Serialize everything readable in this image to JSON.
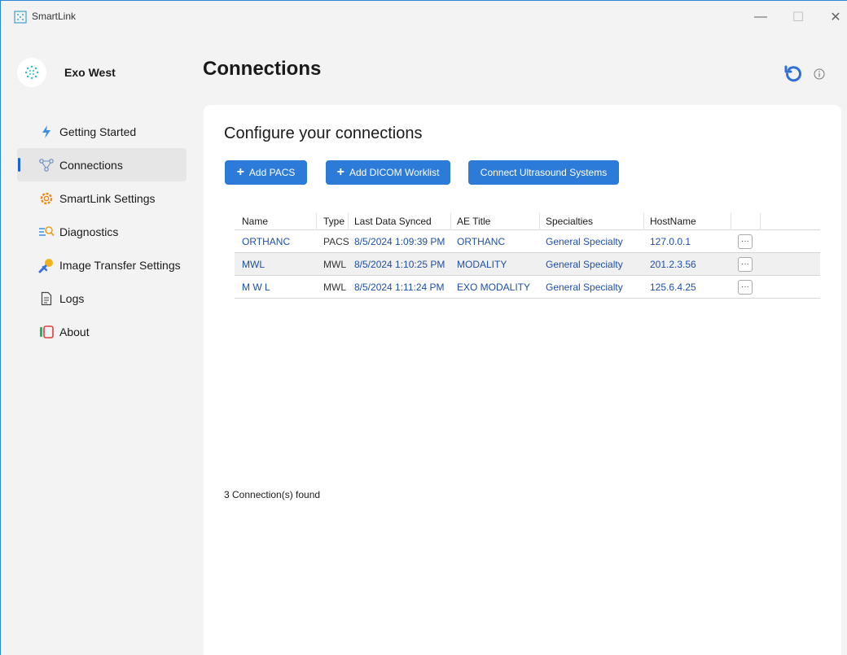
{
  "window": {
    "title": "SmartLink",
    "minimize_glyph": "—",
    "maximize_glyph": "☐",
    "close_glyph": "✕"
  },
  "profile": {
    "name": "Exo West"
  },
  "sidebar": {
    "items": [
      {
        "label": "Getting Started",
        "icon": "lightning-icon",
        "active": false
      },
      {
        "label": "Connections",
        "icon": "network-icon",
        "active": true
      },
      {
        "label": "SmartLink Settings",
        "icon": "gear-icon",
        "active": false
      },
      {
        "label": "Diagnostics",
        "icon": "magnifier-list-icon",
        "active": false
      },
      {
        "label": "Image Transfer Settings",
        "icon": "transfer-icon",
        "active": false
      },
      {
        "label": "Logs",
        "icon": "document-icon",
        "active": false
      },
      {
        "label": "About",
        "icon": "about-icon",
        "active": false
      }
    ]
  },
  "header": {
    "title": "Connections"
  },
  "main": {
    "heading": "Configure your connections",
    "buttons": {
      "add_pacs": "Add PACS",
      "add_worklist": "Add DICOM Worklist",
      "connect_us": "Connect Ultrasound Systems",
      "plus_glyph": "+"
    },
    "table": {
      "headers": [
        "Name",
        "Type",
        "Last Data Synced",
        "AE Title",
        "Specialties",
        "HostName"
      ],
      "rows": [
        {
          "name": "ORTHANC",
          "type": "PACS",
          "synced": "8/5/2024 1:09:39 PM",
          "ae": "ORTHANC",
          "specialty": "General Specialty",
          "host": "127.0.0.1",
          "more": "···"
        },
        {
          "name": "MWL",
          "type": "MWL",
          "synced": "8/5/2024 1:10:25 PM",
          "ae": "MODALITY",
          "specialty": "General Specialty",
          "host": "201.2.3.56",
          "more": "···"
        },
        {
          "name": "M W L",
          "type": "MWL",
          "synced": "8/5/2024 1:11:24 PM",
          "ae": "EXO MODALITY",
          "specialty": "General Specialty",
          "host": "125.6.4.25",
          "more": "···"
        }
      ]
    },
    "count_text": "3 Connection(s) found"
  },
  "colors": {
    "accent": "#2d7bd9",
    "link": "#1f4fa8",
    "active_indicator": "#1e63d6"
  }
}
